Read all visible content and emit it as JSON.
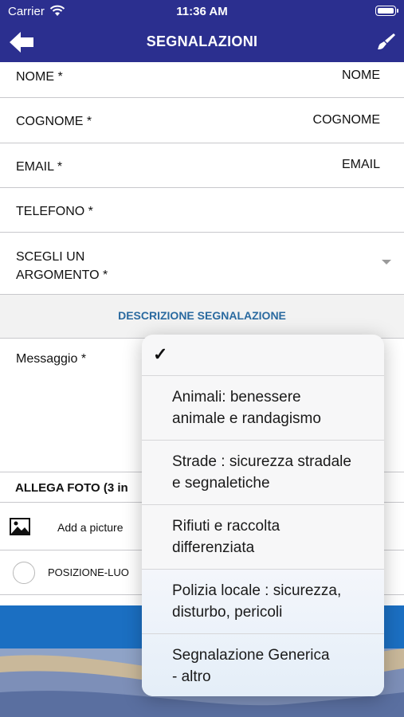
{
  "status_bar": {
    "carrier": "Carrier",
    "time": "11:36 AM"
  },
  "nav": {
    "title": "SEGNALAZIONI",
    "back_icon": "back-arrow-icon",
    "right_icon": "brush-icon"
  },
  "form": {
    "nome": {
      "label": "NOME *",
      "value": "NOME"
    },
    "cognome": {
      "label": "COGNOME *",
      "value": "COGNOME"
    },
    "email": {
      "label": "EMAIL *",
      "value": "EMAIL"
    },
    "telefono": {
      "label": "TELEFONO *"
    },
    "argomento": {
      "label_line1": "SCEGLI UN",
      "label_line2": "ARGOMENTO *"
    },
    "section_title": "DESCRIZIONE SEGNALAZIONE",
    "messaggio": {
      "label": "Messaggio *"
    },
    "allega": "ALLEGA FOTO (3 in",
    "add_picture": "Add a picture",
    "posizione": "POSIZIONE-LUO"
  },
  "picker": {
    "checked_mark": "✓",
    "options": [
      {
        "line1": "Animali: benessere",
        "line2": "animale e randagismo"
      },
      {
        "line1": "Strade : sicurezza stradale",
        "line2": "e segnaletiche"
      },
      {
        "line1": "Rifiuti e raccolta",
        "line2": "differenziata"
      },
      {
        "line1": "Polizia locale : sicurezza,",
        "line2": "disturbo, pericoli"
      },
      {
        "line1": "Segnalazione Generica",
        "line2": "- altro"
      }
    ]
  },
  "colors": {
    "nav_bg": "#2b2f8f",
    "section_text": "#2a6aa0",
    "band_blue": "#1b6fc2"
  }
}
